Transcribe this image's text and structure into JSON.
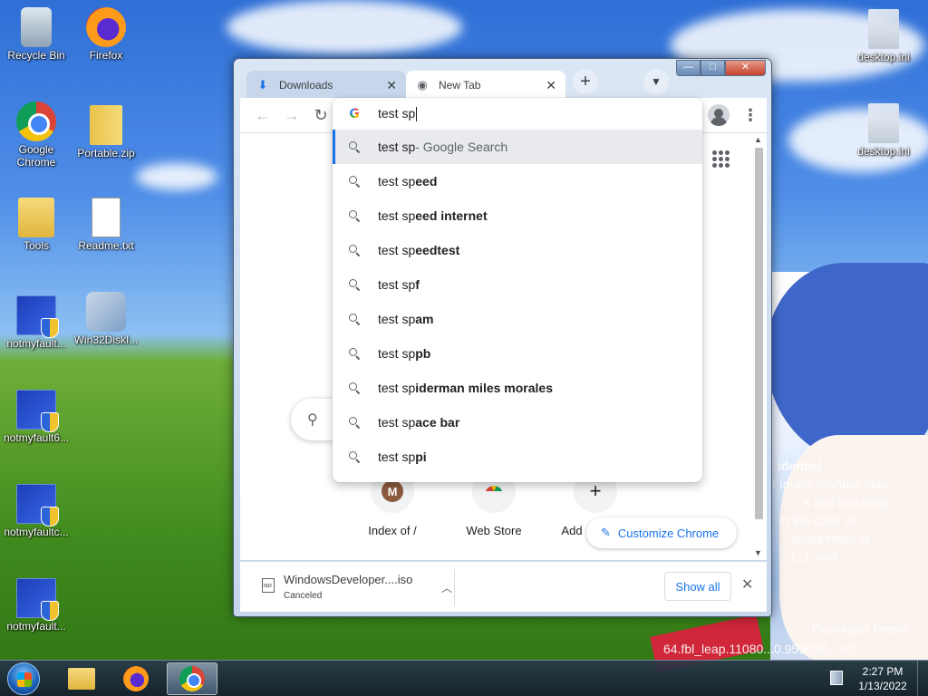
{
  "desktop": {
    "icons": [
      {
        "label": "Recycle Bin",
        "icon": "recycle-bin-icon"
      },
      {
        "label": "Firefox",
        "icon": "firefox-icon"
      },
      {
        "label": "Google Chrome",
        "icon": "chrome-icon"
      },
      {
        "label": "Portable.zip",
        "icon": "zip-folder-icon"
      },
      {
        "label": "Tools",
        "icon": "folder-icon"
      },
      {
        "label": "Readme.txt",
        "icon": "text-file-icon"
      },
      {
        "label": "notmyfault...",
        "icon": "app-shield-icon"
      },
      {
        "label": "Win32DiskI...",
        "icon": "tool-icon"
      },
      {
        "label": "notmyfault6...",
        "icon": "app-shield-icon"
      },
      {
        "label": "notmyfaultc...",
        "icon": "app-shield-icon"
      },
      {
        "label": "notmyfault...",
        "icon": "app-shield-icon"
      },
      {
        "label": "desktop.ini",
        "icon": "ini-file-icon"
      },
      {
        "label": "desktop.ini",
        "icon": "ini-file-icon"
      }
    ],
    "watermark": {
      "heading": "idential",
      "lines": [
        "r in any manner may",
        "s and including",
        "in the case of",
        "assignment or",
        "t...), and"
      ],
      "build_title": "Developer Previe",
      "build_string": "64.fbl_leap.11080...0.959cf95...c0"
    }
  },
  "browser": {
    "tabs": [
      {
        "title": "Downloads",
        "icon": "download-icon",
        "active": false
      },
      {
        "title": "New Tab",
        "icon": "chrome-tab-icon",
        "active": true
      }
    ],
    "window_controls": {
      "minimize": "—",
      "maximize": "□",
      "close": "✕"
    },
    "omnibox": {
      "text": "test sp",
      "suggestions": [
        {
          "typed": "test sp",
          "suffix": "",
          "desc": " - Google Search",
          "selected": true
        },
        {
          "typed": "test sp",
          "suffix": "eed",
          "desc": "",
          "selected": false
        },
        {
          "typed": "test sp",
          "suffix": "eed internet",
          "desc": "",
          "selected": false
        },
        {
          "typed": "test sp",
          "suffix": "eedtest",
          "desc": "",
          "selected": false
        },
        {
          "typed": "test sp",
          "suffix": "f",
          "desc": "",
          "selected": false
        },
        {
          "typed": "test sp",
          "suffix": "am",
          "desc": "",
          "selected": false
        },
        {
          "typed": "test sp",
          "suffix": "pb",
          "desc": "",
          "selected": false
        },
        {
          "typed": "test sp",
          "suffix": "iderman miles morales",
          "desc": "",
          "selected": false
        },
        {
          "typed": "test sp",
          "suffix": "ace bar",
          "desc": "",
          "selected": false
        },
        {
          "typed": "test sp",
          "suffix": "pi",
          "desc": "",
          "selected": false
        }
      ]
    },
    "new_tab_page": {
      "shortcuts": [
        {
          "label": "Index of /",
          "avatar": "M"
        },
        {
          "label": "Web Store",
          "avatar": ""
        },
        {
          "label": "Add",
          "avatar": "+"
        }
      ],
      "customize_label": "Customize Chrome"
    },
    "download_shelf": {
      "filename": "WindowsDeveloper....iso",
      "status": "Canceled",
      "show_all": "Show all"
    }
  },
  "taskbar": {
    "time": "2:27 PM",
    "date": "1/13/2022"
  }
}
